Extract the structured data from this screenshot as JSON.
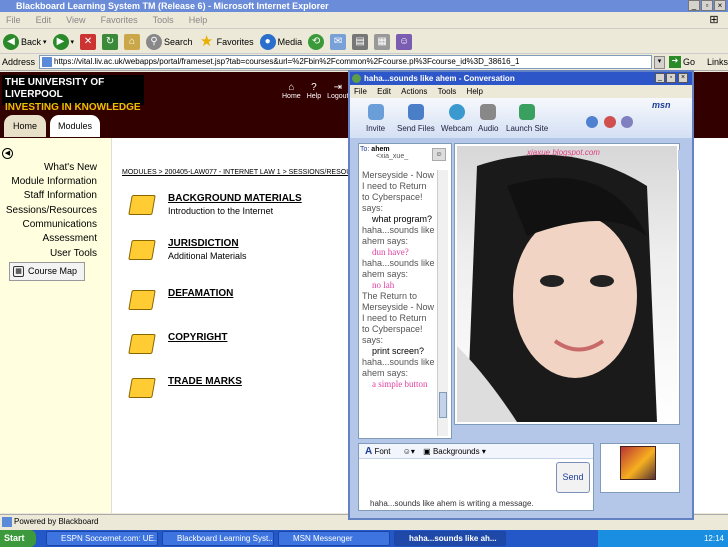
{
  "ie": {
    "title": "Blackboard Learning System TM (Release 6) - Microsoft Internet Explorer",
    "menu": [
      "File",
      "Edit",
      "View",
      "Favorites",
      "Tools",
      "Help"
    ],
    "toolbar": {
      "back": "Back",
      "search": "Search",
      "favorites": "Favorites",
      "media": "Media"
    },
    "address_label": "Address",
    "url": "https://vital.liv.ac.uk/webapps/portal/frameset.jsp?tab=courses&url=%2Fbin%2Fcommon%2Fcourse.pl%3Fcourse_id%3D_38616_1",
    "go": "Go",
    "links": "Links",
    "status": "Powered by Blackboard"
  },
  "bb": {
    "logo_line1": "THE UNIVERSITY OF LIVERPOOL",
    "logo_line2": "INVESTING IN KNOWLEDGE",
    "header_links": [
      "Home",
      "Help",
      "Logout"
    ],
    "tabs": [
      "Home",
      "Modules"
    ],
    "nav": [
      "What's New",
      "Module Information",
      "Staff Information",
      "Sessions/Resources",
      "Communications",
      "Assessment",
      "User Tools"
    ],
    "course_map": "Course Map",
    "breadcrumb": "MODULES > 200405-LAW077 - INTERNET LAW 1 > SESSIONS/RESOUR",
    "modules": [
      {
        "title": "BACKGROUND MATERIALS",
        "subtitle": "Introduction to the Internet"
      },
      {
        "title": "JURISDICTION",
        "subtitle": "Additional Materials"
      },
      {
        "title": "DEFAMATION",
        "subtitle": ""
      },
      {
        "title": "COPYRIGHT",
        "subtitle": ""
      },
      {
        "title": "TRADE MARKS",
        "subtitle": ""
      }
    ]
  },
  "msn": {
    "title": "haha...sounds like ahem - Conversation",
    "menu": [
      "File",
      "Edit",
      "Actions",
      "Tools",
      "Help"
    ],
    "tools": [
      "Invite",
      "Send Files",
      "Webcam",
      "Audio",
      "Launch Site"
    ],
    "logo": "msn",
    "to_label": "To:",
    "to_name": "ahem",
    "to_email": "<xia_xue_",
    "chat": [
      {
        "type": "txt",
        "text": "Merseyside - Now I need to Return to Cyberspace! says:"
      },
      {
        "type": "msg",
        "text": "what program?"
      },
      {
        "type": "txt",
        "text": "haha...sounds like ahem says:"
      },
      {
        "type": "pk",
        "text": "dun have?"
      },
      {
        "type": "txt",
        "text": "haha...sounds like ahem says:"
      },
      {
        "type": "pk",
        "text": "no lah"
      },
      {
        "type": "txt",
        "text": "The Return to Merseyside - Now I need to Return to Cyberspace! says:"
      },
      {
        "type": "msg",
        "text": "print screen?"
      },
      {
        "type": "txt",
        "text": "haha...sounds like ahem says:"
      },
      {
        "type": "pk",
        "text": "a simple button"
      }
    ],
    "photo_caption": "xiaxue.blogspot.com",
    "font_label": "Font",
    "backgrounds_label": "Backgrounds",
    "send": "Send",
    "typing": "haha...sounds like ahem is writing a message."
  },
  "taskbar": {
    "start": "Start",
    "tasks": [
      "ESPN Soccernet.com: UE...",
      "Blackboard Learning Syst...",
      "MSN Messenger",
      "haha...sounds like ah..."
    ],
    "clock": "12:14"
  },
  "colors": {
    "bb_header": "#330000",
    "bb_nav_bg": "#ffffe0",
    "msn_title": "#2d56c9",
    "taskbar": "#2457c8"
  }
}
